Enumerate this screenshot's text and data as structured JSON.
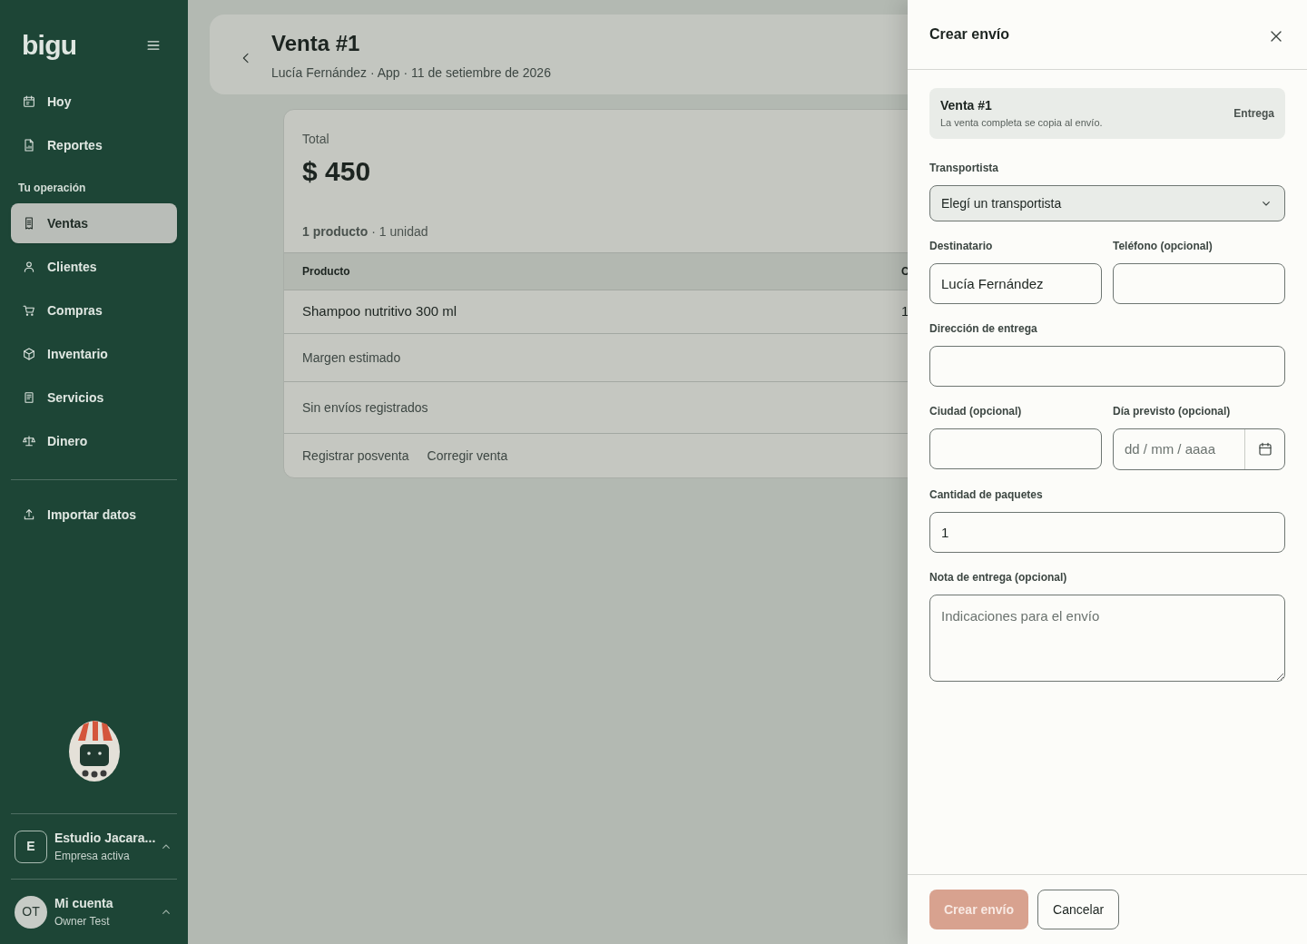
{
  "sidebar": {
    "logo": "bigu",
    "groups": [
      {
        "items": [
          {
            "label": "Hoy",
            "kind": "calendar",
            "selected": false
          },
          {
            "label": "Reportes",
            "kind": "report",
            "selected": false
          }
        ]
      },
      {
        "heading": "Tu operación",
        "items": [
          {
            "label": "Ventas",
            "kind": "receipt",
            "selected": true
          },
          {
            "label": "Clientes",
            "kind": "person",
            "selected": false
          },
          {
            "label": "Compras",
            "kind": "cart",
            "selected": false
          },
          {
            "label": "Inventario",
            "kind": "box",
            "selected": false
          },
          {
            "label": "Servicios",
            "kind": "document",
            "selected": false
          },
          {
            "label": "Dinero",
            "kind": "scale",
            "selected": false
          }
        ]
      },
      {
        "items": [
          {
            "label": "Importar datos",
            "kind": "upload",
            "selected": false
          }
        ]
      }
    ],
    "company": {
      "initial": "E",
      "name": "Estudio Jacara...",
      "subtitle": "Empresa activa"
    },
    "account": {
      "initials": "OT",
      "name": "Mi cuenta",
      "subtitle": "Owner Test"
    }
  },
  "header": {
    "title": "Venta #1",
    "subtitle": "Lucía Fernández · App · 11 de setiembre de 2026"
  },
  "summary": {
    "total_label": "Total",
    "total": "$ 450",
    "count": "**1 producto** · 1 unidad",
    "table": {
      "columns": [
        "Producto",
        "C"
      ],
      "rows": [
        [
          "Shampoo nutritivo 300 ml",
          "1"
        ]
      ]
    },
    "margin": "Margen estimado",
    "shipments": "Sin envíos registrados",
    "actions": [
      "Registrar posventa",
      "Corregir venta"
    ]
  },
  "drawer": {
    "title": "Crear envío",
    "sale": {
      "title": "Venta #1",
      "text": "La venta completa se copia al envío.",
      "tag": "Entrega"
    },
    "rows": [
      [
        {
          "kind": "select",
          "label": "Transportista",
          "value": "Elegí un transportista"
        }
      ],
      [
        {
          "kind": "text",
          "label": "Destinatario",
          "value": "Lucía Fernández"
        },
        {
          "kind": "text",
          "label": "Teléfono (opcional)"
        }
      ],
      [
        {
          "kind": "text",
          "label": "Dirección de entrega"
        }
      ],
      [
        {
          "kind": "text",
          "label": "Ciudad (opcional)"
        },
        {
          "kind": "date",
          "label": "Día previsto (opcional)",
          "placeholder": "dd / mm / aaaa"
        }
      ],
      [
        {
          "kind": "text",
          "label": "Cantidad de paquetes",
          "value": "1"
        }
      ],
      [
        {
          "kind": "textarea",
          "label": "Nota de entrega (opcional)",
          "placeholder": "Indicaciones para el envío"
        }
      ]
    ],
    "primary": {
      "label": "Crear envío",
      "disabled": true
    },
    "secondary": {
      "label": "Cancelar"
    }
  }
}
